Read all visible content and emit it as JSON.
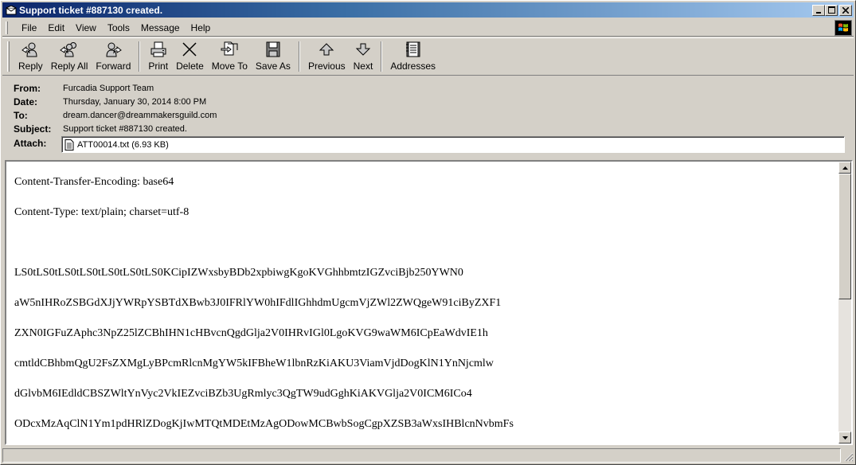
{
  "window": {
    "title": "Support ticket #887130 created.",
    "buttons": {
      "minimize": "_",
      "maximize": "□",
      "close": "×"
    }
  },
  "menu": [
    {
      "label": "File",
      "icon": ""
    },
    {
      "label": "Edit"
    },
    {
      "label": "View"
    },
    {
      "label": "Tools"
    },
    {
      "label": "Message"
    },
    {
      "label": "Help"
    }
  ],
  "toolbar": {
    "reply": {
      "label": "Reply",
      "icon": "reply-icon"
    },
    "reply_all": {
      "label": "Reply All",
      "icon": "reply-all-icon"
    },
    "forward": {
      "label": "Forward",
      "icon": "forward-icon"
    },
    "print": {
      "label": "Print",
      "icon": "printer-icon"
    },
    "delete": {
      "label": "Delete",
      "icon": "delete-x-icon"
    },
    "move_to": {
      "label": "Move To",
      "icon": "move-to-folder-icon"
    },
    "save_as": {
      "label": "Save As",
      "icon": "floppy-disk-icon"
    },
    "previous": {
      "label": "Previous",
      "icon": "up-arrow-icon"
    },
    "next": {
      "label": "Next",
      "icon": "down-arrow-icon"
    },
    "addresses": {
      "label": "Addresses",
      "icon": "address-book-icon"
    }
  },
  "headers": {
    "from_label": "From:",
    "from": "Furcadia Support Team",
    "date_label": "Date:",
    "date": "Thursday, January 30, 2014 8:00 PM",
    "to_label": "To:",
    "to": "dream.dancer@dreammakersguild.com",
    "subject_label": "Subject:",
    "subject": "Support ticket #887130 created.",
    "attach_label": "Attach:",
    "attachment": "ATT00014.txt (6.93 KB)"
  },
  "body": {
    "lines": [
      "Content-Transfer-Encoding: base64",
      "Content-Type: text/plain; charset=utf-8",
      "",
      "LS0tLS0tLS0tLS0tLS0tLS0tLS0KCipIZWxsbyBDb2xpbiwgKgoKVGhhbmtzIGZvciBjb250YWN0",
      "aW5nIHRoZSBGdXJjYWRpYSBTdXBwb3J0IFRlYW0hIFdlIGhhdmUgcmVjZWl2ZWQgeW91ciByZXF1",
      "ZXN0IGFuZAphc3NpZ25lZCBhIHN1cHBvcnQgdGlja2V0IHRvIGl0LgoKVG9waWM6ICpEaWdvIE1h",
      "cmtldCBhbmQgU2FsZXMgLyBPcmRlcnMgYW5kIFBheW1lbnRzKiAKU3ViamVjdDogKlN1YnNjcmlw",
      "dGlvbM6IEdldCBSZWltYnVyc2VkIEZvciBZb3UgRmlyc3QgTW9udGghKiAKVGlja2V0ICM6ICo4",
      "ODcxMzAqClN1Ym1pdHRlZDogKjIwMTQtMDEtMzAgODowMCBwbSogCgpXZSB3aWxsIHBlcnNvbmFs"
    ]
  }
}
